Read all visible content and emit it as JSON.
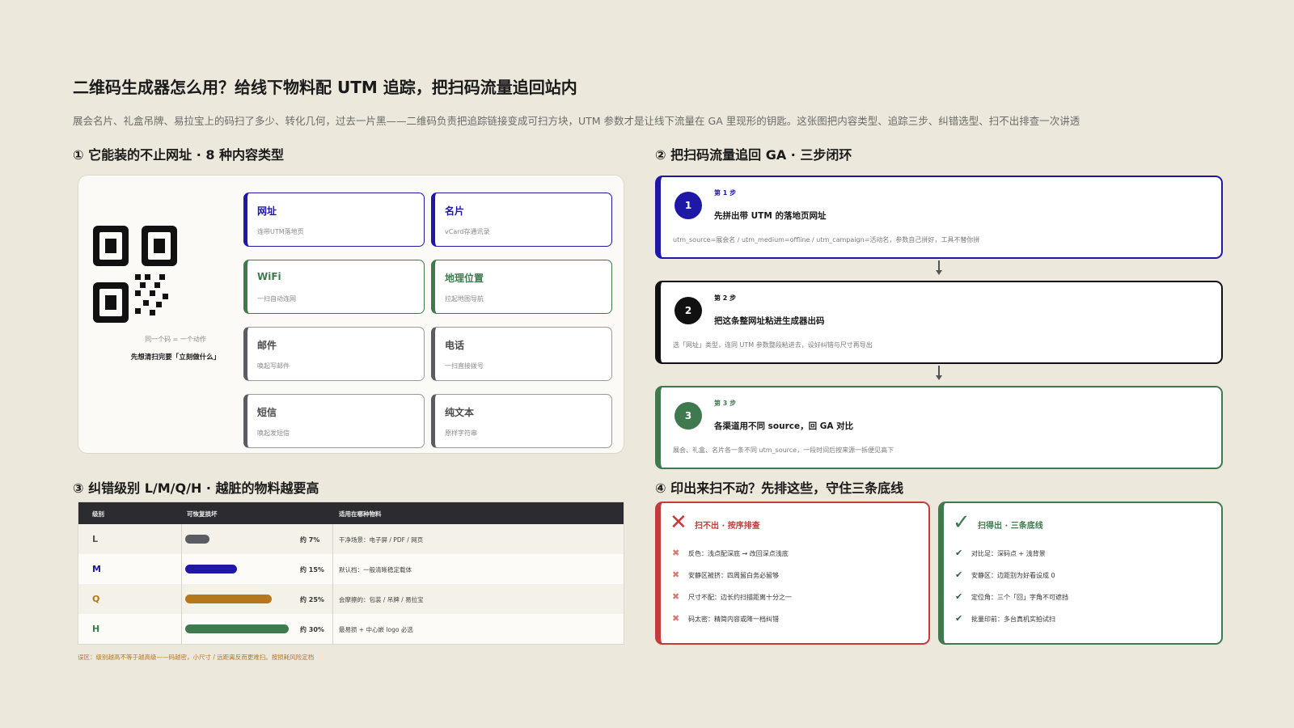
{
  "page": {
    "title": "二维码生成器怎么用？给线下物料配 UTM 追踪，把扫码流量追回站内",
    "subtitle": "展会名片、礼盒吊牌、易拉宝上的码扫了多少、转化几何，过去一片黑——二维码负责把追踪链接变成可扫方块，UTM 参数才是让线下流量在 GA 里现形的钥匙。这张图把内容类型、追踪三步、纠错选型、扫不出排查一次讲透"
  },
  "section1": {
    "title": "① 它能装的不止网址 · 8 种内容类型",
    "qr_caption1": "同一个码 = 一个动作",
    "qr_caption2": "先想清扫完要「立刻做什么」",
    "types": [
      {
        "label": "网址",
        "desc": "连带UTM落地页",
        "style": "blue"
      },
      {
        "label": "名片",
        "desc": "vCard存通讯录",
        "style": "blue"
      },
      {
        "label": "WiFi",
        "desc": "一扫自动连网",
        "style": "green"
      },
      {
        "label": "地理位置",
        "desc": "拉起地图导航",
        "style": "green"
      },
      {
        "label": "邮件",
        "desc": "唤起写邮件",
        "style": "gray"
      },
      {
        "label": "电话",
        "desc": "一扫直接拨号",
        "style": "gray"
      },
      {
        "label": "短信",
        "desc": "唤起发短信",
        "style": "gray"
      },
      {
        "label": "纯文本",
        "desc": "原样字符串",
        "style": "gray"
      }
    ]
  },
  "section2": {
    "title": "② 把扫码流量追回 GA · 三步闭环",
    "steps": [
      {
        "num": "1",
        "kicker": "第 1 步",
        "title": "先拼出带 UTM 的落地页网址",
        "desc": "utm_source=展会名 / utm_medium=offline / utm_campaign=活动名，参数自己拼好，工具不替你拼"
      },
      {
        "num": "2",
        "kicker": "第 2 步",
        "title": "把这条整网址粘进生成器出码",
        "desc": "选「网址」类型，连同 UTM 参数整段粘进去，设好纠错与尺寸再导出"
      },
      {
        "num": "3",
        "kicker": "第 3 步",
        "title": "各渠道用不同 source，回 GA 对比",
        "desc": "展会、礼盒、名片各一条不同 utm_source，一段时间后按来源一拆便见高下"
      }
    ]
  },
  "section3": {
    "title": "③ 纠错级别 L/M/Q/H · 越脏的物料越要高",
    "headers": [
      "级别",
      "可恢复损坏",
      "适用在哪种物料"
    ],
    "rows": [
      {
        "level": "L",
        "recover": 0.07,
        "pct": "约 7%",
        "use": "干净场景：电子屏 / PDF / 网页",
        "color": "#5b5b63"
      },
      {
        "level": "M",
        "recover": 0.15,
        "pct": "约 15%",
        "use": "默认档：一般清晰稳定载体",
        "color": "#1f17a8"
      },
      {
        "level": "Q",
        "recover": 0.25,
        "pct": "约 25%",
        "use": "会摩擦的：包装 / 吊牌 / 易拉宝",
        "color": "#b5771b"
      },
      {
        "level": "H",
        "recover": 0.3,
        "pct": "约 30%",
        "use": "最易损 + 中心嵌 logo 必选",
        "color": "#3f7a4f"
      }
    ],
    "note": "误区：级别越高不等于越高级——码越密，小尺寸 / 远距离反而更难扫。按损耗风险定档"
  },
  "section4": {
    "title": "④ 印出来扫不动？先排这些，守住三条底线",
    "fail": {
      "icon": "x-mark-icon",
      "title": "扫不出 · 按序排查",
      "items": [
        "反色：浅点配深底 → 改回深点浅底",
        "安静区被挤：四周留白务必留够",
        "尺寸不配：边长约扫描距离十分之一",
        "码太密：精简内容或降一档纠错"
      ]
    },
    "pass": {
      "icon": "check-mark-icon",
      "title": "扫得出 · 三条底线",
      "items": [
        "对比足：深码点 + 浅背景",
        "安静区：边距别为好看设成 0",
        "定位角：三个「回」字角不可遮挡",
        "批量印前：多台真机实拍试扫"
      ]
    }
  }
}
